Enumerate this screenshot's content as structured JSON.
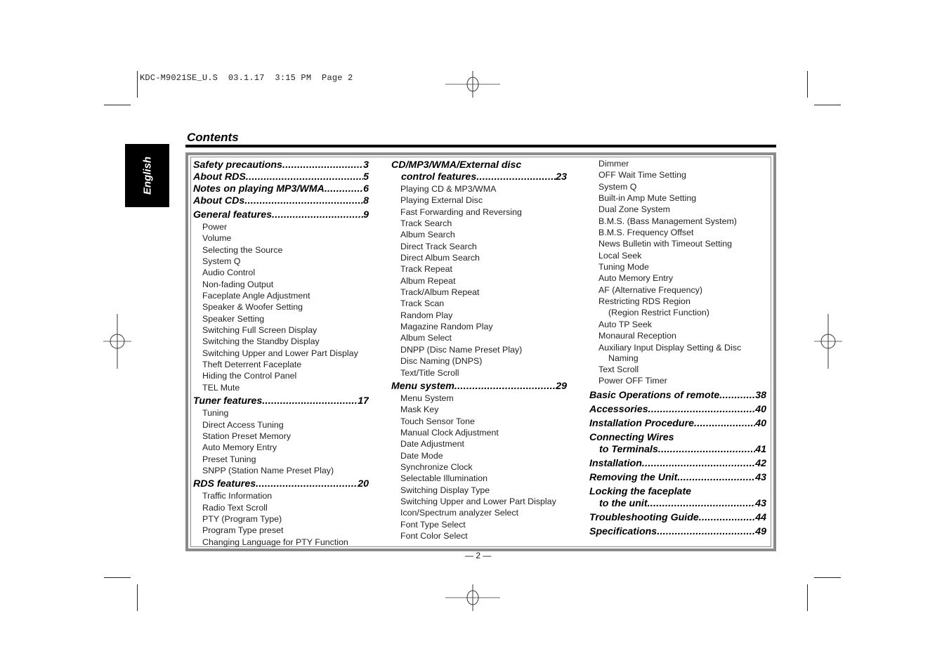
{
  "slug": "KDC-M9021SE_U.S  03.1.17  3:15 PM  Page 2",
  "language_tab": "English",
  "title": "Contents",
  "page_number": "— 2 —",
  "col1": {
    "heads": [
      {
        "label": "Safety precautions",
        "page": "3"
      },
      {
        "label": "About RDS ",
        "page": "5"
      },
      {
        "label": "Notes on playing MP3/WMA",
        "page": "6"
      },
      {
        "label": "About CDs",
        "page": "8"
      },
      {
        "label": "General features ",
        "page": "9"
      },
      {
        "label": "Tuner features",
        "page": "17"
      },
      {
        "label": "RDS features",
        "page": "20"
      }
    ],
    "general": [
      "Power",
      "Volume",
      "Selecting the Source",
      "System Q",
      "Audio Control",
      "Non-fading Output",
      "Faceplate Angle Adjustment",
      "Speaker & Woofer Setting",
      "Speaker Setting",
      "Switching Full Screen Display",
      "Switching the Standby Display",
      "Switching Upper and Lower Part Display",
      "Theft Deterrent Faceplate",
      "Hiding the Control Panel",
      "TEL Mute"
    ],
    "tuner": [
      "Tuning",
      "Direct Access Tuning",
      "Station Preset Memory",
      "Auto Memory Entry",
      "Preset Tuning",
      "SNPP (Station Name Preset Play)"
    ],
    "rds": [
      "Traffic Information",
      "Radio Text Scroll",
      "PTY (Program Type)",
      "Program Type preset",
      "Changing Language for PTY Function"
    ]
  },
  "col2": {
    "cd_head_line1": "CD/MP3/WMA/External disc",
    "cd_head_line2": {
      "label": "control features ",
      "page": "23"
    },
    "cd": [
      "Playing CD & MP3/WMA",
      "Playing External Disc",
      "Fast Forwarding and Reversing",
      "Track Search",
      "Album Search",
      "Direct Track Search",
      "Direct Album Search",
      "Track Repeat",
      "Album Repeat",
      "Track/Album Repeat",
      "Track Scan",
      "Random Play",
      "Magazine Random Play",
      "Album Select",
      "DNPP (Disc Name Preset Play)",
      "Disc Naming (DNPS)",
      "Text/Title Scroll"
    ],
    "menu_head": {
      "label": "Menu system",
      "page": "29"
    },
    "menu": [
      "Menu System",
      "Mask Key",
      "Touch Sensor Tone",
      "Manual Clock Adjustment",
      "Date Adjustment",
      "Date Mode",
      "Synchronize Clock",
      "Selectable Illumination",
      "Switching Display Type",
      "Switching Upper and Lower Part Display",
      "Icon/Spectrum analyzer Select",
      "Font Type Select",
      "Font Color Select"
    ]
  },
  "col3": {
    "menu_cont": [
      "Dimmer",
      "OFF Wait Time Setting",
      "System Q",
      "Built-in Amp Mute Setting",
      "Dual Zone System",
      "B.M.S. (Bass Management System)",
      "B.M.S. Frequency Offset",
      "News Bulletin with Timeout Setting",
      "Local Seek",
      "Tuning Mode",
      "Auto Memory Entry",
      "AF (Alternative Frequency)",
      "Restricting RDS Region"
    ],
    "restrict_cont": "(Region Restrict Function)",
    "menu_cont2": [
      "Auto TP Seek",
      "Monaural Reception",
      "Auxiliary Input Display Setting & Disc"
    ],
    "aux_cont": "Naming",
    "menu_cont3": [
      "Text Scroll",
      "Power OFF Timer"
    ],
    "heads": [
      {
        "label": "Basic Operations of remote",
        "page": "38"
      },
      {
        "label": "Accessories",
        "page": "40"
      },
      {
        "label": "Installation Procedure ",
        "page": "40"
      }
    ],
    "wires_line1": "Connecting Wires",
    "wires_line2": {
      "label": "to Terminals ",
      "page": "41"
    },
    "heads2": [
      {
        "label": "Installation ",
        "page": "42"
      },
      {
        "label": "Removing the Unit",
        "page": "43"
      }
    ],
    "lock_line1": "Locking the faceplate",
    "lock_line2": {
      "label": "to the unit ",
      "page": "43"
    },
    "heads3": [
      {
        "label": "Troubleshooting Guide ",
        "page": "44"
      },
      {
        "label": "Specifications ",
        "page": "49"
      }
    ]
  }
}
